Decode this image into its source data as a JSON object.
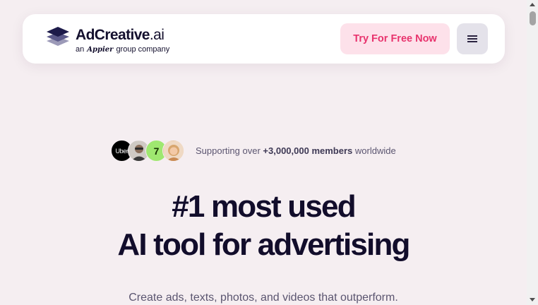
{
  "header": {
    "logo_name": "AdCreative",
    "logo_suffix": ".ai",
    "logo_sub_prefix": "an",
    "logo_sub_brand": "Appier",
    "logo_sub_suffix": "group company",
    "cta_label": "Try For Free Now",
    "menu_icon": "hamburger-icon"
  },
  "hero": {
    "avatars": [
      {
        "name": "uber-logo",
        "text": "Uber"
      },
      {
        "name": "person-avatar"
      },
      {
        "name": "wise-logo",
        "text": "7"
      },
      {
        "name": "person-avatar"
      }
    ],
    "proof_prefix": "Supporting over",
    "proof_highlight": "+3,000,000 members",
    "proof_suffix": "worldwide",
    "headline_line1": "#1 most used",
    "headline_line2": "AI tool for advertising",
    "subheadline": "Create ads, texts, photos, and videos that outperform."
  },
  "colors": {
    "background": "#f5eef1",
    "accent": "#e8336d",
    "cta_background": "#fde1ea",
    "text": "#120d2b"
  }
}
